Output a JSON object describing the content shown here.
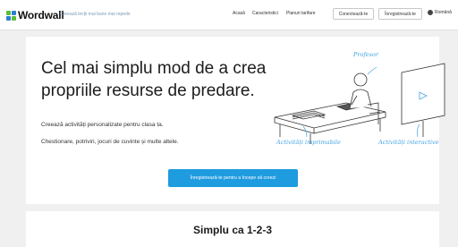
{
  "header": {
    "logo_text": "Wordwall",
    "tagline": "Creează lecții mai bune mai repede",
    "nav": [
      "Acasă",
      "Caracteristici",
      "Planuri tarifare"
    ],
    "login_label": "Conectează-te",
    "signup_label": "Înregistrează-te",
    "language": "Română"
  },
  "hero": {
    "title": "Cel mai simplu mod de a crea propriile resurse de predare.",
    "subtitle_1": "Creează activități personalizate pentru clasa ta.",
    "subtitle_2": "Chestionare, potriviri, jocuri de cuvinte și multe altele.",
    "cta_label": "Înregistrează-te pentru a începe să creezi",
    "illustration": {
      "label_teacher": "Profesor",
      "label_printable": "Activități imprimabile",
      "label_interactive": "Activități interactive"
    }
  },
  "section2": {
    "title": "Simplu ca 1-2-3"
  },
  "colors": {
    "accent": "#1f9be0",
    "illustration_blue": "#46a4e2",
    "logo_blue": "#2a7fd4",
    "logo_green": "#5bbd3a"
  }
}
